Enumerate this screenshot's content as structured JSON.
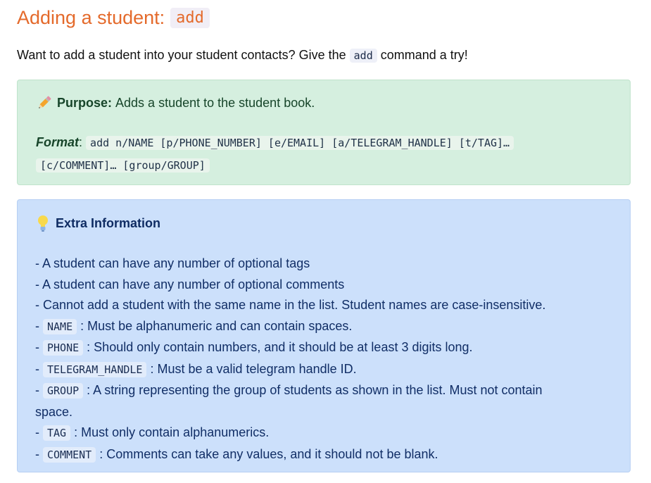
{
  "heading": {
    "text": "Adding a student:",
    "code": "add"
  },
  "intro": {
    "before": "Want to add a student into your student contacts? Give the",
    "code": "add",
    "after": "command a try!"
  },
  "purpose_box": {
    "purpose_label": "Purpose:",
    "purpose_text": "Adds a student to the student book.",
    "format_label": "Format",
    "format_colon": ":",
    "format_code_1": "add n/NAME [p/PHONE_NUMBER] [e/EMAIL] [a/TELEGRAM_HANDLE] [t/TAG]…",
    "format_code_2": "[c/COMMENT]… [group/GROUP]"
  },
  "info_box": {
    "title": "Extra Information",
    "lines": [
      "- A student can have any number of optional tags",
      "- A student can have any number of optional comments",
      "- Cannot add a student with the same name in the list. Student names are case-insensitive."
    ],
    "fields": [
      {
        "code": "NAME",
        "text": ": Must be alphanumeric and can contain spaces."
      },
      {
        "code": "PHONE",
        "text": ": Should only contain numbers, and it should be at least 3 digits long."
      },
      {
        "code": "TELEGRAM_HANDLE",
        "text": ": Must be a valid telegram handle ID."
      },
      {
        "code": "GROUP",
        "text": ": A string representing the group of students as shown in the list. Must not contain",
        "continuation": "space."
      },
      {
        "code": "TAG",
        "text": ": Must only contain alphanumerics."
      },
      {
        "code": "COMMENT",
        "text": ": Comments can take any values, and it should not be blank."
      }
    ]
  },
  "icons": {
    "purpose": "pencil-icon",
    "info": "lightbulb-icon"
  }
}
